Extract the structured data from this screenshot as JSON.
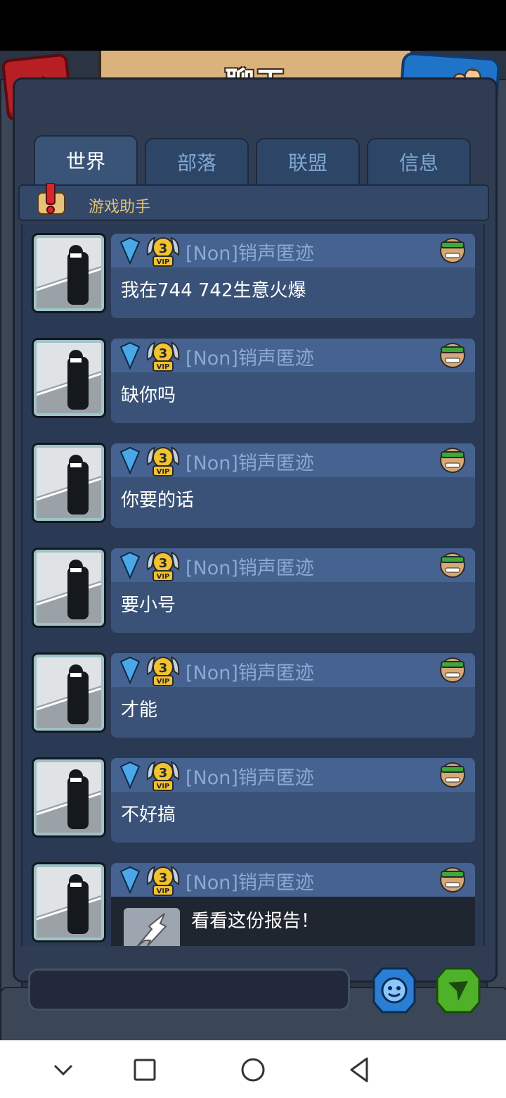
{
  "header": {
    "title": "聊天"
  },
  "tabs": [
    {
      "label": "世界",
      "active": true
    },
    {
      "label": "部落",
      "active": false
    },
    {
      "label": "联盟",
      "active": false
    },
    {
      "label": "信息",
      "active": false
    }
  ],
  "helper": {
    "label": "游戏助手"
  },
  "messages": [
    {
      "sender": "[Non]销声匿迹",
      "vip": "3",
      "text": "我在744 742生意火爆"
    },
    {
      "sender": "[Non]销声匿迹",
      "vip": "3",
      "text": "缺你吗"
    },
    {
      "sender": "[Non]销声匿迹",
      "vip": "3",
      "text": "你要的话"
    },
    {
      "sender": "[Non]销声匿迹",
      "vip": "3",
      "text": "要小号"
    },
    {
      "sender": "[Non]销声匿迹",
      "vip": "3",
      "text": "才能"
    },
    {
      "sender": "[Non]销声匿迹",
      "vip": "3",
      "text": "不好搞"
    },
    {
      "sender": "[Non]销声匿迹",
      "vip": "3",
      "text": "看看这份报告！"
    }
  ],
  "input": {
    "value": "",
    "placeholder": ""
  },
  "icons": {
    "close": "close-icon",
    "profile": "profile-icon",
    "emoji": "emoji-icon",
    "send": "send-icon"
  },
  "colors": {
    "accent_gold": "#dcb27c",
    "close_red": "#b81f25",
    "profile_blue": "#1f74c9",
    "send_green": "#4fb02a",
    "sender_name": "#8aaad4",
    "helper_label": "#e2c074"
  }
}
